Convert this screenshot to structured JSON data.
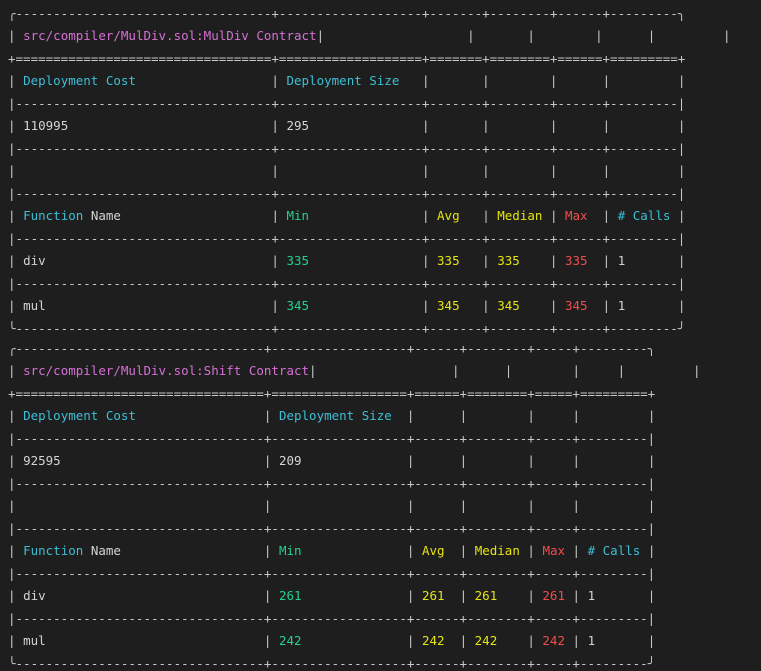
{
  "colors": {
    "background": "#1e1e1e",
    "text": "#d4d4d4",
    "contract_name": "#d670d6",
    "header_label": "#3dbfd6",
    "min": "#23d18b",
    "avg_median": "#e5e510",
    "max": "#f14c4c"
  },
  "tables": [
    {
      "widths": [
        34,
        19,
        7,
        8,
        6,
        9
      ],
      "contract": "src/compiler/MulDiv.sol:MulDiv Contract",
      "deployment_cost_label": "Deployment Cost",
      "deployment_size_label": "Deployment Size",
      "deployment_cost": "110995",
      "deployment_size": "295",
      "headers": {
        "function": "Function",
        "name": "Name",
        "min": "Min",
        "avg": "Avg",
        "median": "Median",
        "max": "Max",
        "calls": "# Calls"
      },
      "functions": [
        {
          "name": "div",
          "min": "335",
          "avg": "335",
          "median": "335",
          "max": "335",
          "calls": "1"
        },
        {
          "name": "mul",
          "min": "345",
          "avg": "345",
          "median": "345",
          "max": "345",
          "calls": "1"
        }
      ]
    },
    {
      "widths": [
        33,
        18,
        6,
        8,
        5,
        9
      ],
      "contract": "src/compiler/MulDiv.sol:Shift Contract",
      "deployment_cost_label": "Deployment Cost",
      "deployment_size_label": "Deployment Size",
      "deployment_cost": "92595",
      "deployment_size": "209",
      "headers": {
        "function": "Function",
        "name": "Name",
        "min": "Min",
        "avg": "Avg",
        "median": "Median",
        "max": "Max",
        "calls": "# Calls"
      },
      "functions": [
        {
          "name": "div",
          "min": "261",
          "avg": "261",
          "median": "261",
          "max": "261",
          "calls": "1"
        },
        {
          "name": "mul",
          "min": "242",
          "avg": "242",
          "median": "242",
          "max": "242",
          "calls": "1"
        }
      ]
    }
  ]
}
